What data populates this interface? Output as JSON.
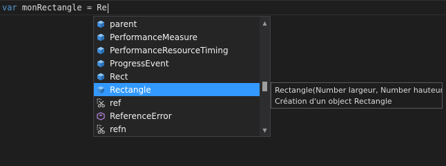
{
  "editor": {
    "code": {
      "keyword": "var",
      "rest": " monRectangle = Re"
    }
  },
  "completion": {
    "items": [
      {
        "label": "parent",
        "icon": "cube-icon"
      },
      {
        "label": "PerformanceMeasure",
        "icon": "cube-icon"
      },
      {
        "label": "PerformanceResourceTiming",
        "icon": "cube-icon"
      },
      {
        "label": "ProgressEvent",
        "icon": "cube-icon"
      },
      {
        "label": "Rect",
        "icon": "cube-icon"
      },
      {
        "label": "Rectangle",
        "icon": "cube-icon",
        "selected": true
      },
      {
        "label": "ref",
        "icon": "snippet-icon"
      },
      {
        "label": "ReferenceError",
        "icon": "object-icon"
      },
      {
        "label": "refn",
        "icon": "snippet-icon"
      }
    ],
    "scroll_position": 0.62
  },
  "tooltip": {
    "signature": "Rectangle(Number largeur, Number hauteur)",
    "description": "Création d'un object Rectangle"
  },
  "colors": {
    "background": "#1e1e1e",
    "keyword": "#569cd6",
    "selection": "#3399ff",
    "cube_icon": "#5aa4e6",
    "object_icon": "#b180d7"
  }
}
